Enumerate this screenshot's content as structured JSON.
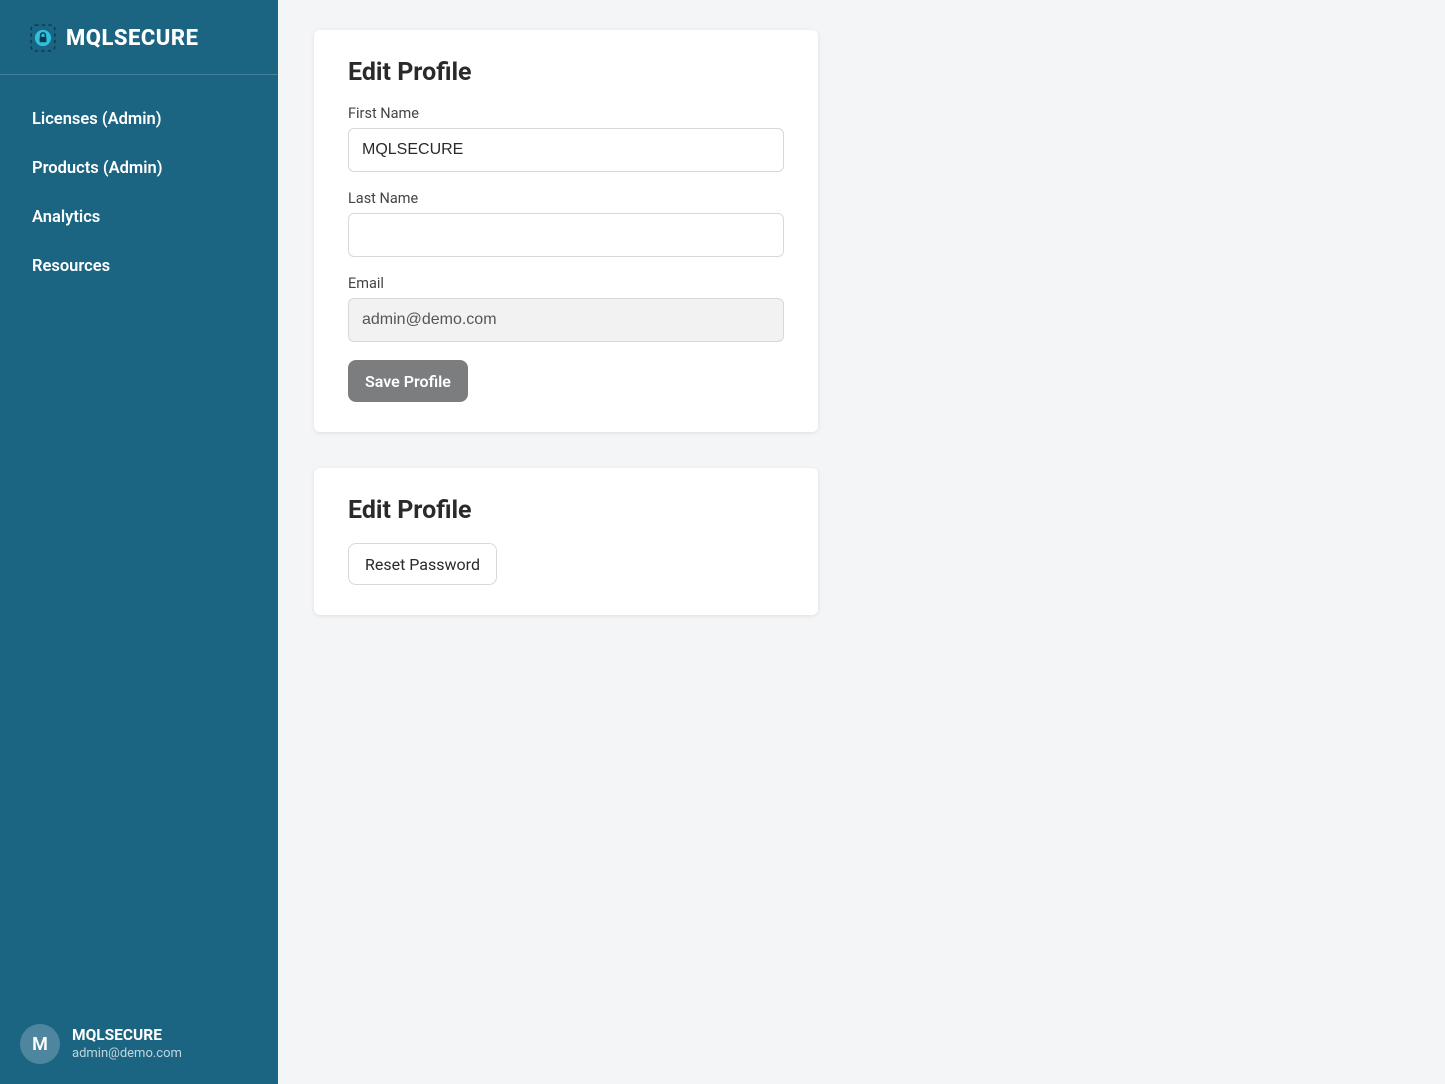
{
  "brand": {
    "name": "MQLSECURE"
  },
  "sidebar": {
    "items": [
      {
        "label": "Licenses (Admin)"
      },
      {
        "label": "Products (Admin)"
      },
      {
        "label": "Analytics"
      },
      {
        "label": "Resources"
      }
    ]
  },
  "user": {
    "initial": "M",
    "name": "MQLSECURE",
    "email": "admin@demo.com"
  },
  "profile_card": {
    "title": "Edit Profile",
    "first_name_label": "First Name",
    "first_name_value": "MQLSECURE",
    "last_name_label": "Last Name",
    "last_name_value": "",
    "email_label": "Email",
    "email_value": "admin@demo.com",
    "save_button": "Save Profile"
  },
  "password_card": {
    "title": "Edit Profile",
    "reset_button": "Reset Password"
  }
}
